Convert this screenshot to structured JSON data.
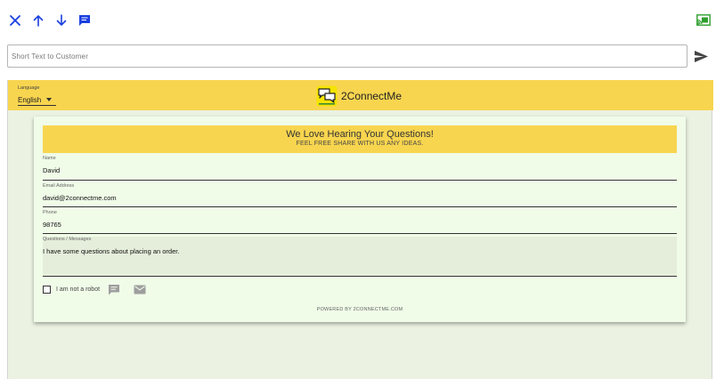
{
  "toolbar": {
    "icons": [
      "close-icon",
      "arrow-up-icon",
      "arrow-down-icon",
      "chat-icon"
    ],
    "accent_color": "#1a3fe0",
    "cast_icon": "cast-icon",
    "cast_color": "#2e9e2e"
  },
  "message_bar": {
    "placeholder": "Short Text to Customer",
    "value": "",
    "send_icon": "send-icon"
  },
  "header": {
    "language_label": "Language",
    "language_value": "English",
    "brand_name": "2ConnectMe",
    "background": "#f8d54f"
  },
  "form": {
    "title": "We Love Hearing Your Questions!",
    "subtitle": "FEEL FREE SHARE WITH US ANY IDEAS.",
    "fields": {
      "name": {
        "label": "Name",
        "value": "David"
      },
      "email": {
        "label": "Email Address",
        "value": "david@2connectme.com"
      },
      "phone": {
        "label": "Phone",
        "value": "98765"
      },
      "questions": {
        "label": "Questions / Messages",
        "value": "I have some questions about placing an order."
      }
    },
    "robot_label": "I am not a robot",
    "robot_checked": false,
    "chat_icon": "chat-icon",
    "mail_icon": "mail-icon",
    "footer": "POWERED BY 2CONNECTME.COM"
  }
}
